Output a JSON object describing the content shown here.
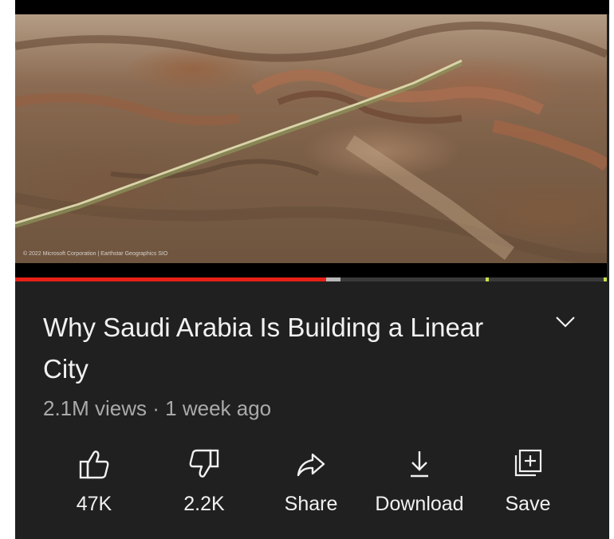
{
  "video": {
    "watermark": "© 2022 Microsoft Corporation | Earthstar Geographics SIO",
    "progress": {
      "played_fraction": 0.525,
      "buffered_fraction": 0.55,
      "chapter_markers": [
        0.795,
        0.995
      ]
    }
  },
  "details": {
    "title": "Why Saudi Arabia Is Building a Linear City",
    "meta": "2.1M views · 1 week ago"
  },
  "actions": {
    "like": {
      "icon": "thumbs-up-icon",
      "label": "47K"
    },
    "dislike": {
      "icon": "thumbs-down-icon",
      "label": "2.2K"
    },
    "share": {
      "icon": "share-arrow-icon",
      "label": "Share"
    },
    "download": {
      "icon": "download-icon",
      "label": "Download"
    },
    "save": {
      "icon": "playlist-add-icon",
      "label": "Save"
    }
  },
  "colors": {
    "background": "#202020",
    "progress_played": "#e62117",
    "progress_marker": "#c9e04a",
    "text_primary": "#f1f1f1",
    "text_secondary": "#aaaaaa"
  }
}
